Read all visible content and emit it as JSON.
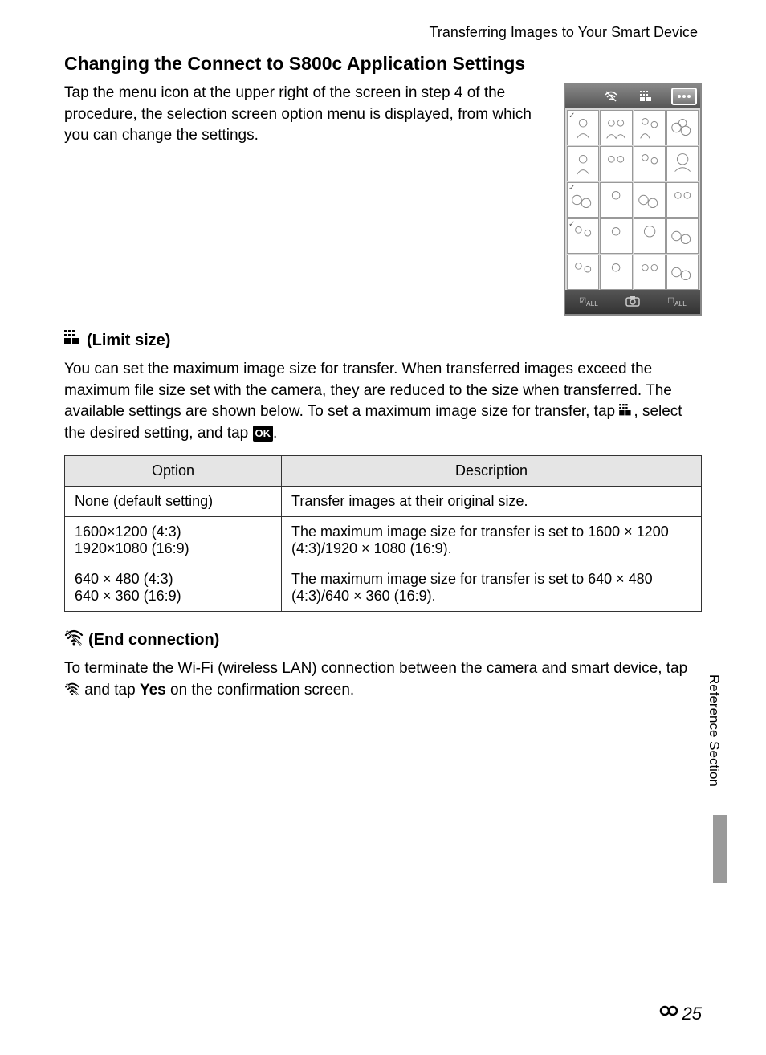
{
  "header": {
    "breadcrumb": "Transferring Images to Your Smart Device"
  },
  "heading": "Changing the Connect to S800c Application Settings",
  "intro": "Tap the menu icon at the upper right of the screen in step 4 of the procedure, the selection screen option menu is displayed, from which you can change the settings.",
  "limit_size": {
    "title": "(Limit size)",
    "body_before": "You can set the maximum image size for transfer. When transferred images exceed the maximum file size set with the camera, they are reduced to the size when transferred. The available settings are shown below. To set a maximum image size for transfer, tap ",
    "body_mid": ", select the desired setting, and tap ",
    "body_end": "."
  },
  "table": {
    "headers": [
      "Option",
      "Description"
    ],
    "rows": [
      {
        "option": "None (default setting)",
        "desc": "Transfer images at their original size."
      },
      {
        "option": "1600×1200 (4:3)\n1920×1080 (16:9)",
        "desc": "The maximum image size for transfer is set to 1600 × 1200 (4:3)/1920 × 1080 (16:9)."
      },
      {
        "option": "640 × 480 (4:3)\n640 × 360 (16:9)",
        "desc": "The maximum image size for transfer is set to 640 × 480 (4:3)/640 × 360 (16:9)."
      }
    ]
  },
  "end_connection": {
    "title": "(End connection)",
    "body_before": "To terminate the Wi-Fi (wireless LAN) connection between the camera and smart device, tap ",
    "body_mid": " and tap ",
    "yes": "Yes",
    "body_end": " on the confirmation screen."
  },
  "sidebar": "Reference Section",
  "page": "25",
  "ok": "OK",
  "screenshot": {
    "botbar": [
      "ALL",
      "",
      "ALL"
    ]
  }
}
